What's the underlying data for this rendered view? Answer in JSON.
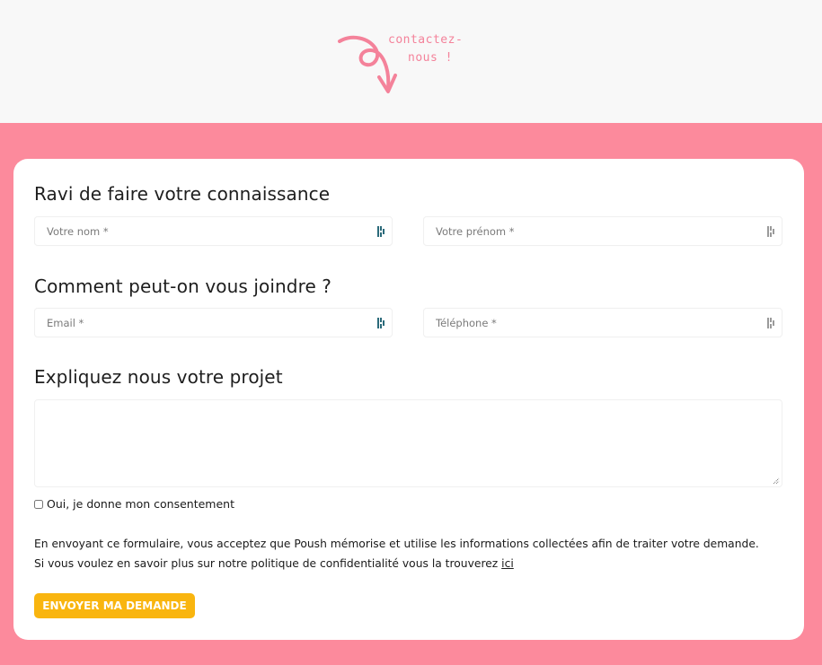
{
  "header": {
    "doodle_line1": "contactez-",
    "doodle_line2": "nous !",
    "accent_color": "#f4829a"
  },
  "colors": {
    "background_top": "#f8f8f8",
    "background_pink": "#fc8a9c",
    "card": "#ffffff",
    "button": "#f9b50f"
  },
  "form": {
    "section1_title": "Ravi de faire votre connaissance",
    "section2_title": "Comment peut-on vous joindre ?",
    "section3_title": "Expliquez nous votre projet",
    "fields": {
      "nom": {
        "placeholder": "Votre nom *",
        "value": ""
      },
      "prenom": {
        "placeholder": "Votre prénom *",
        "value": ""
      },
      "email": {
        "placeholder": "Email *",
        "value": ""
      },
      "telephone": {
        "placeholder": "Téléphone *",
        "value": ""
      },
      "projet": {
        "placeholder": "",
        "value": ""
      }
    },
    "consent_label": "Oui, je donne mon consentement",
    "consent_checked": false,
    "legal_line1": "En envoyant ce formulaire, vous acceptez que Poush mémorise et utilise les informations collectées afin de traiter votre demande.",
    "legal_line2": "Si vous voulez en savoir plus sur notre politique de confidentialité vous la trouverez ",
    "legal_link": "ici",
    "submit_label": "ENVOYER MA DEMANDE"
  }
}
